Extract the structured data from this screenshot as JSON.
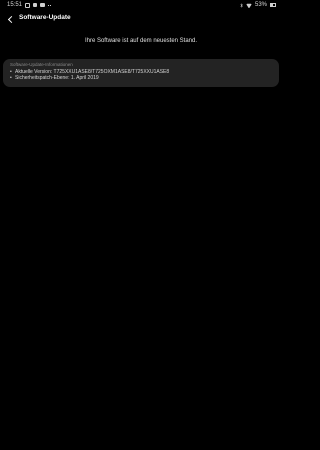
{
  "status_bar": {
    "time": "15:51",
    "battery_percent": "53%",
    "battery_level": 0.53,
    "left_icons": [
      "notification-icon",
      "gallery-icon",
      "youtube-icon",
      "more-dots-icon"
    ],
    "right_icons": [
      "bluetooth-icon",
      "wifi-icon",
      "battery-icon"
    ]
  },
  "app_bar": {
    "back_icon": "back-arrow-icon",
    "title": "Software-Update"
  },
  "status_message": "Ihre Software ist auf dem neuesten Stand.",
  "info_card": {
    "title": "Software-Update-Informationen",
    "lines": [
      "Aktuelle Version: T725XXU1ASE8/T725OXM1ASE8/T725XXU1ASE8",
      "Sicherheitspatch-Ebene: 1. April 2019"
    ]
  },
  "colors": {
    "background": "#000000",
    "card": "#232323",
    "text_primary": "#ffffff",
    "text_secondary": "#8a8a8a"
  }
}
